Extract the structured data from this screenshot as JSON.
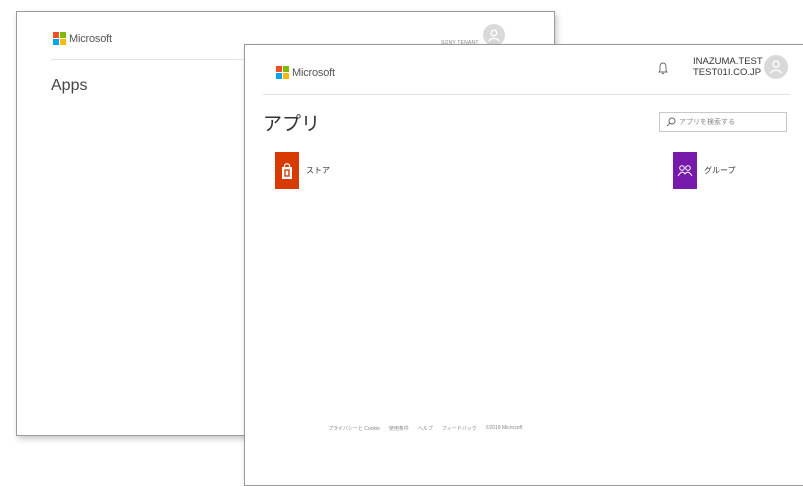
{
  "back_window": {
    "brand": "Microsoft",
    "user": "SONY TENANT",
    "title": "Apps"
  },
  "front_window": {
    "brand": "Microsoft",
    "user": {
      "name": "INAZUMA.TEST",
      "domain": "TEST01I.CO.JP"
    },
    "title": "アプリ",
    "search": {
      "placeholder": "アプリを検索する"
    },
    "apps": [
      {
        "label": "ストア",
        "icon": "store-bag-icon",
        "color": "#d83b01"
      },
      {
        "label": "グループ",
        "icon": "groups-icon",
        "color": "#7719aa"
      }
    ],
    "footer": [
      "プライバシーと Cookie",
      "使用条件",
      "ヘルプ",
      "フィードバック",
      "©2018 Microsoft"
    ]
  },
  "colors": {
    "ms_red": "#f25022",
    "ms_green": "#7fba00",
    "ms_blue": "#00a4ef",
    "ms_yellow": "#ffb900"
  }
}
